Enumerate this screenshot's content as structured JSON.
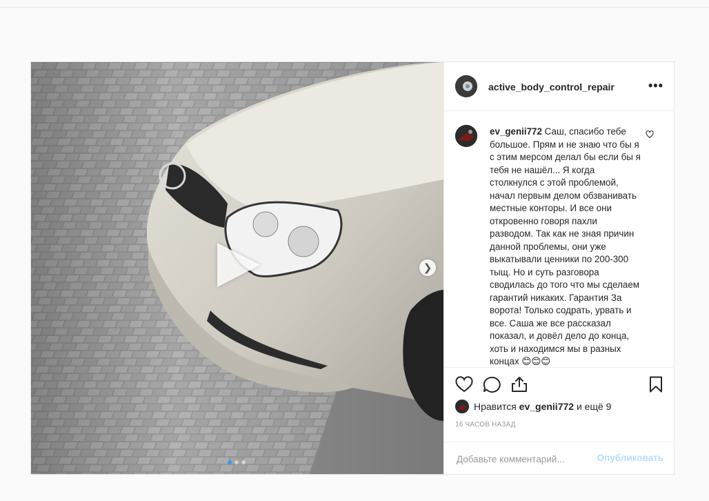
{
  "post": {
    "author": {
      "username": "active_body_control_repair",
      "avatar_icon": "profile-avatar"
    },
    "more_icon": "more-options-icon",
    "media": {
      "type": "video",
      "play_icon": "play-icon",
      "next_icon": "chevron-right-icon",
      "carousel_count": 3,
      "carousel_active": 0
    },
    "comment": {
      "username": "ev_genii772",
      "text": "Саш, спасибо тебе большое. Прям и не знаю что бы я с этим мерсом делал бы если бы я тебя не нашёл... Я когда столкнулся с этой проблемой, начал первым делом обзванивать местные конторы. И все они откровенно говоря пахли разводом. Так как не зная причин данной проблемы, они уже выкатывали ценники по 200-300 тыщ. Но и суть разговора сводилась до того что мы сделаем гарантий никаких. Гарантия За ворота! Только содрать, урвать и все. Саша же все рассказал показал, и довёл дело до конца, хоть и находимся мы в разных концах 😊😊😊"
    },
    "actions": {
      "like_icon": "heart-icon",
      "comment_icon": "comment-icon",
      "share_icon": "share-icon",
      "save_icon": "bookmark-icon"
    },
    "likes": {
      "prefix": "Нравится ",
      "user": "ev_genii772",
      "suffix": " и ещё 9"
    },
    "timestamp": "16 часов назад",
    "add_comment": {
      "placeholder": "Добавьте комментарий...",
      "publish_label": "Опубликовать"
    },
    "colors": {
      "accent": "#3897f0",
      "publish_disabled": "#b2dffc"
    }
  }
}
